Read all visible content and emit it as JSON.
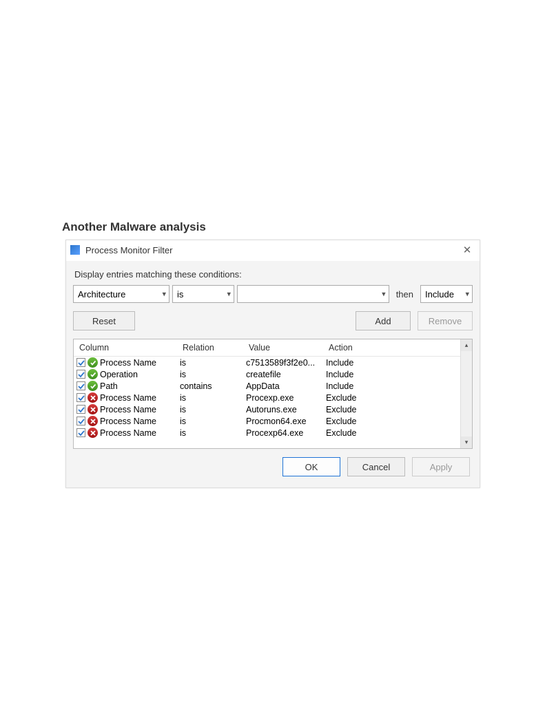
{
  "page_title": "Another Malware analysis",
  "dialog": {
    "title": "Process Monitor Filter",
    "close_glyph": "✕",
    "instruction": "Display entries matching these conditions:",
    "filter": {
      "column_select": "Architecture",
      "relation_select": "is",
      "value_select": "",
      "then_label": "then",
      "action_select": "Include"
    },
    "buttons": {
      "reset": "Reset",
      "add": "Add",
      "remove": "Remove",
      "ok": "OK",
      "cancel": "Cancel",
      "apply": "Apply"
    },
    "list": {
      "headers": {
        "column": "Column",
        "relation": "Relation",
        "value": "Value",
        "action": "Action"
      },
      "rows": [
        {
          "checked": true,
          "status": "include",
          "column": "Process Name",
          "relation": "is",
          "value": "c7513589f3f2e0...",
          "action": "Include"
        },
        {
          "checked": true,
          "status": "include",
          "column": "Operation",
          "relation": "is",
          "value": "createfile",
          "action": "Include"
        },
        {
          "checked": true,
          "status": "include",
          "column": "Path",
          "relation": "contains",
          "value": "AppData",
          "action": "Include"
        },
        {
          "checked": true,
          "status": "exclude",
          "column": "Process Name",
          "relation": "is",
          "value": "Procexp.exe",
          "action": "Exclude"
        },
        {
          "checked": true,
          "status": "exclude",
          "column": "Process Name",
          "relation": "is",
          "value": "Autoruns.exe",
          "action": "Exclude"
        },
        {
          "checked": true,
          "status": "exclude",
          "column": "Process Name",
          "relation": "is",
          "value": "Procmon64.exe",
          "action": "Exclude"
        },
        {
          "checked": true,
          "status": "exclude",
          "column": "Process Name",
          "relation": "is",
          "value": "Procexp64.exe",
          "action": "Exclude"
        }
      ]
    }
  }
}
